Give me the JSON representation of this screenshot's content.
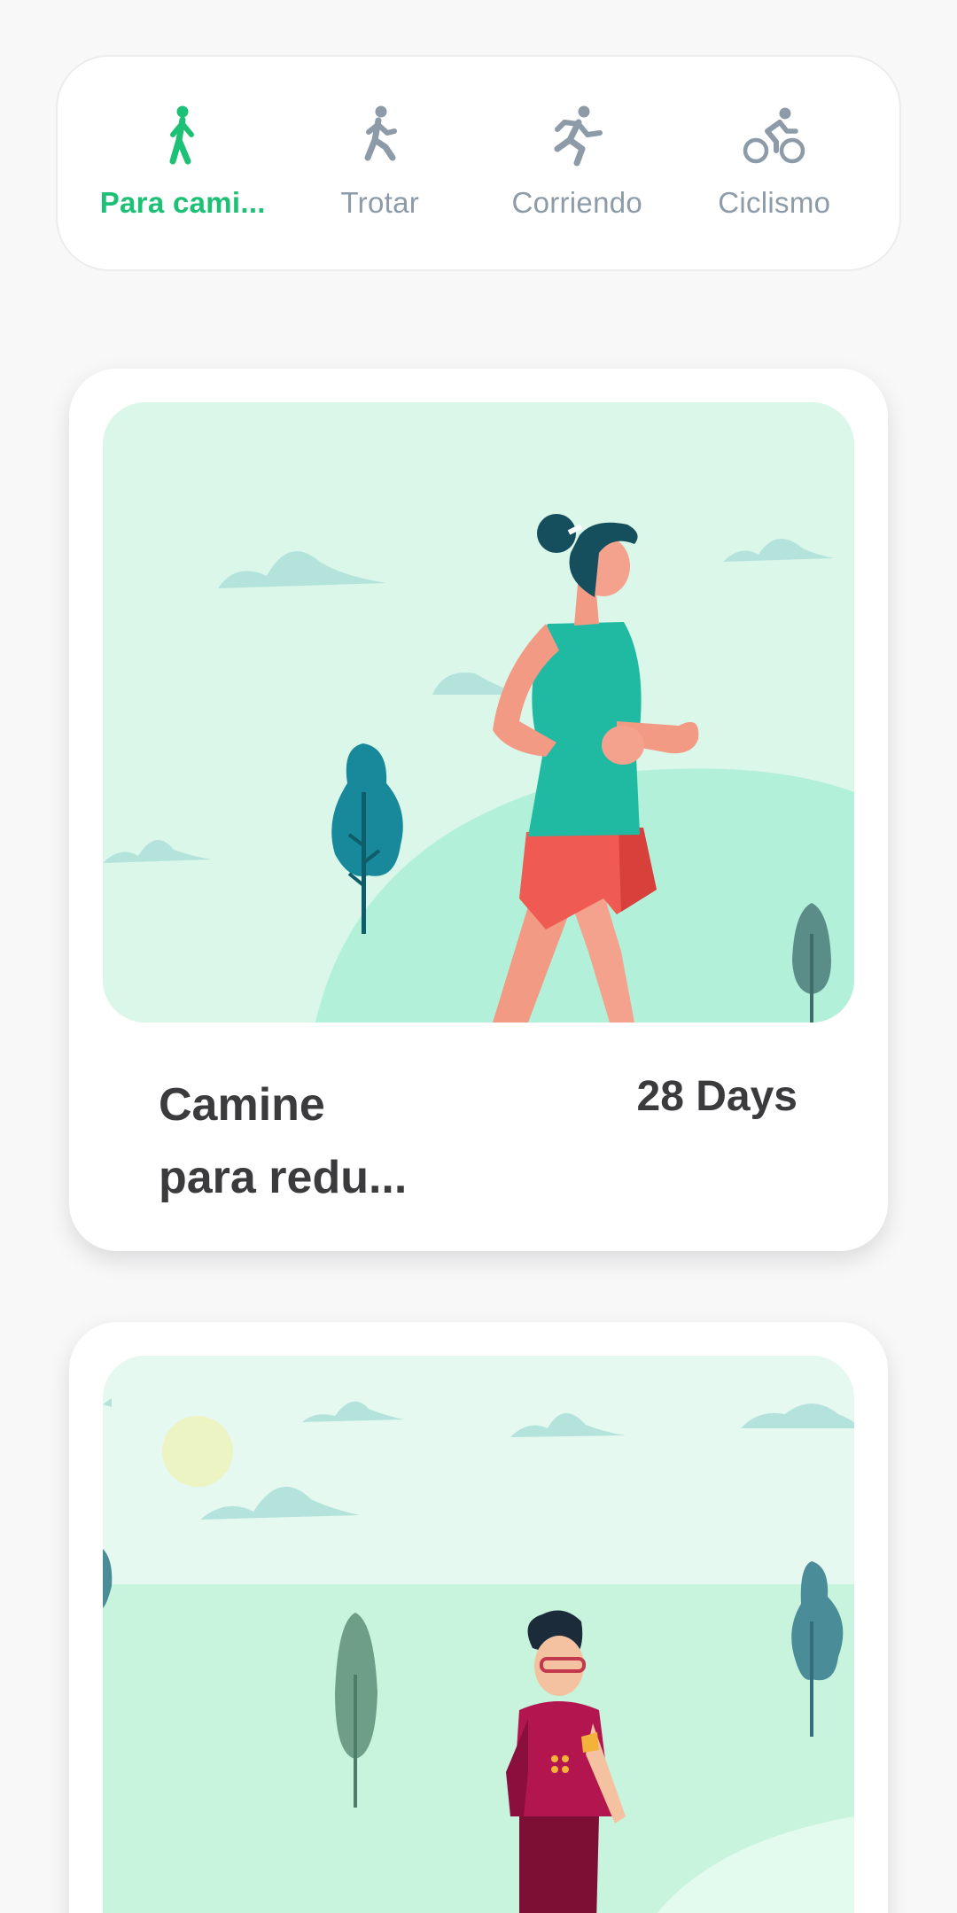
{
  "activity_tabs": [
    {
      "label": "Para cami...",
      "icon": "walking-icon",
      "active": true
    },
    {
      "label": "Trotar",
      "icon": "jogging-icon",
      "active": false
    },
    {
      "label": "Corriendo",
      "icon": "running-icon",
      "active": false
    },
    {
      "label": "Ciclismo",
      "icon": "cycling-icon",
      "active": false
    }
  ],
  "plans": [
    {
      "title_line1": "Camine",
      "title_line2": "para redu...",
      "duration": "28 Days",
      "image": "woman-jogging-illustration"
    },
    {
      "image": "man-walking-illustration"
    }
  ],
  "colors": {
    "accent": "#1dc176",
    "inactive": "#8c9ba7",
    "text": "#3b3b3d",
    "illustration_bg": "#daf7ea"
  }
}
